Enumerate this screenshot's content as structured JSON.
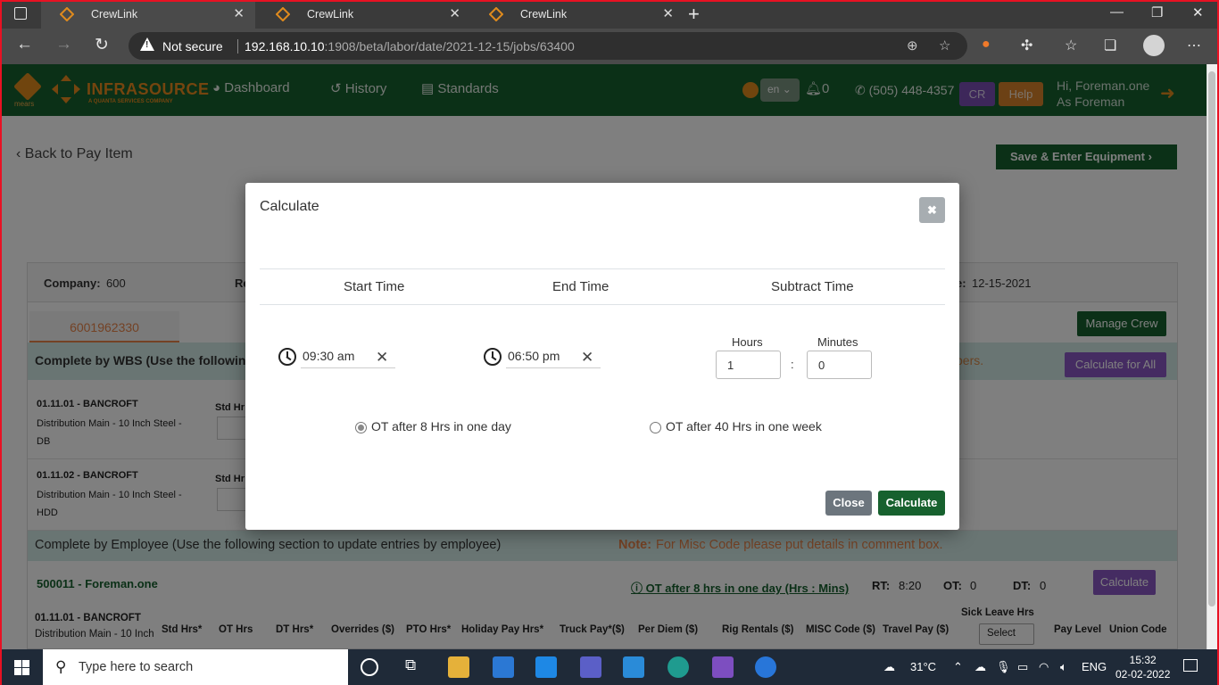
{
  "browser": {
    "tabs": [
      {
        "label": "CrewLink",
        "active": true
      },
      {
        "label": "CrewLink",
        "active": false
      },
      {
        "label": "CrewLink",
        "active": false
      }
    ],
    "security_label": "Not secure",
    "url_host": "192.168.10.10",
    "url_rest": ":1908/beta/labor/date/2021-12-15/jobs/63400"
  },
  "header": {
    "logo_text": "INFRASOURCE",
    "logo_subtext": "A QUANTA SERVICES COMPANY",
    "logo_mears": "mears",
    "nav": [
      "Dashboard",
      "History",
      "Standards"
    ],
    "language": "en",
    "notification_count": "0",
    "phone": "(505) 448-4357",
    "cr_label": "CR",
    "help_label": "Help",
    "greeting_line1": "Hi, Foreman.one",
    "greeting_line2": "As Foreman"
  },
  "page": {
    "back_label": "Back to Pay Item",
    "save_label": "Save & Enter Equipment",
    "company_label": "Company:",
    "company_value": "600",
    "company_trail": "Re",
    "date_label": "e:",
    "date_value": "12-15-2021",
    "tab_label": "6001962330",
    "manage_crew_label": "Manage Crew",
    "wbs_section": "Complete by WBS (Use the followin",
    "wbs_section_tail": "bers.",
    "calc_all_label": "Calculate for All",
    "wbs_rows": [
      {
        "code": "01.11.01 - BANCROFT",
        "desc": "Distribution Main - 10 Inch Steel - DB",
        "std_label": "Std Hr"
      },
      {
        "code": "01.11.02 - BANCROFT",
        "desc": "Distribution Main - 10 Inch Steel - HDD",
        "std_label": "Std Hr"
      }
    ],
    "employee_section": "Complete by Employee (Use the following section to update entries by employee)",
    "note_label": "Note:",
    "note_text": "For Misc Code please put details in comment box.",
    "employee": "500011 - Foreman.one",
    "ot_link": "OT after 8 hrs in one day (Hrs : Mins)",
    "rt_label": "RT:",
    "rt_value": "8:20",
    "ot_label": "OT:",
    "ot_value": "0",
    "dt_label": "DT:",
    "dt_value": "0",
    "calc_label": "Calculate",
    "row_code": "01.11.01 - BANCROFT",
    "row_desc": "Distribution Main - 10 Inch",
    "columns": [
      "Std Hrs*",
      "OT Hrs",
      "DT Hrs*",
      "Overrides ($)",
      "PTO Hrs*",
      "Holiday Pay Hrs*",
      "Truck Pay*($)",
      "Per Diem ($)",
      "Rig Rentals ($)",
      "MISC Code ($)",
      "Travel Pay ($)",
      "Sick Leave Hrs",
      "Pay Level",
      "Union Code"
    ],
    "sick_select": "Select"
  },
  "modal": {
    "title": "Calculate",
    "col_start": "Start Time",
    "col_end": "End Time",
    "col_subtract": "Subtract Time",
    "start_time": "09:30 am",
    "end_time": "06:50 pm",
    "hours_label": "Hours",
    "minutes_label": "Minutes",
    "hours_value": "1",
    "minutes_value": "0",
    "colon": ":",
    "option_day": "OT after 8 Hrs in one day",
    "option_week": "OT after 40 Hrs in one week",
    "selected_option": "day",
    "close_label": "Close",
    "calculate_label": "Calculate"
  },
  "taskbar": {
    "search_placeholder": "Type here to search",
    "temperature": "31°C",
    "language": "ENG",
    "time": "15:32",
    "date": "02-02-2022"
  },
  "colors": {
    "brand_green": "#17612e",
    "brand_orange": "#ea8a1e",
    "purple": "#8a58c4"
  }
}
